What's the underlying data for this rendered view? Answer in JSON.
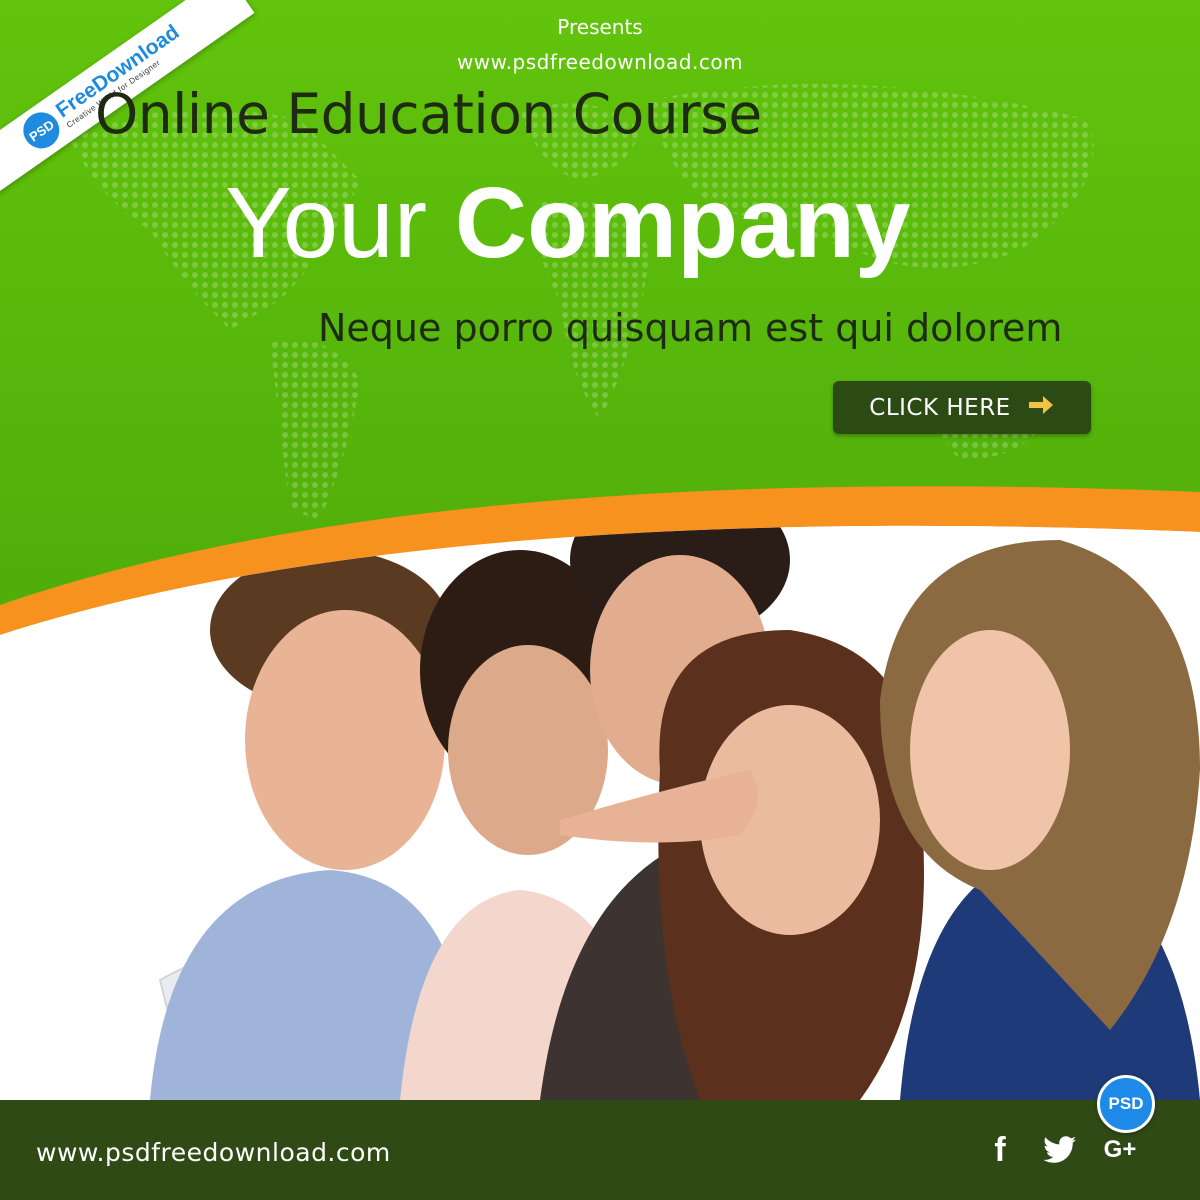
{
  "ribbon": {
    "badge": "PSD",
    "brand": "FreeDownload",
    "tagline": "Creative World for Designer"
  },
  "header": {
    "presents": "Presents",
    "url": "www.psdfreedownload.com"
  },
  "hero": {
    "course_title": "Online Education Course",
    "headline_light": "Your",
    "headline_bold": "Company",
    "tagline": "Neque porro quisquam est qui dolorem"
  },
  "cta": {
    "label": "CLICK HERE",
    "icon": "arrow-right-icon"
  },
  "footer": {
    "url": "www.psdfreedownload.com",
    "social": {
      "facebook": "f",
      "twitter": "twitter-bird-icon",
      "googleplus": "G+"
    },
    "badge": "PSD"
  },
  "colors": {
    "green": "#5dbb0c",
    "dark_green": "#2f4a15",
    "orange": "#f7921e",
    "brand_blue": "#1e8be0"
  }
}
